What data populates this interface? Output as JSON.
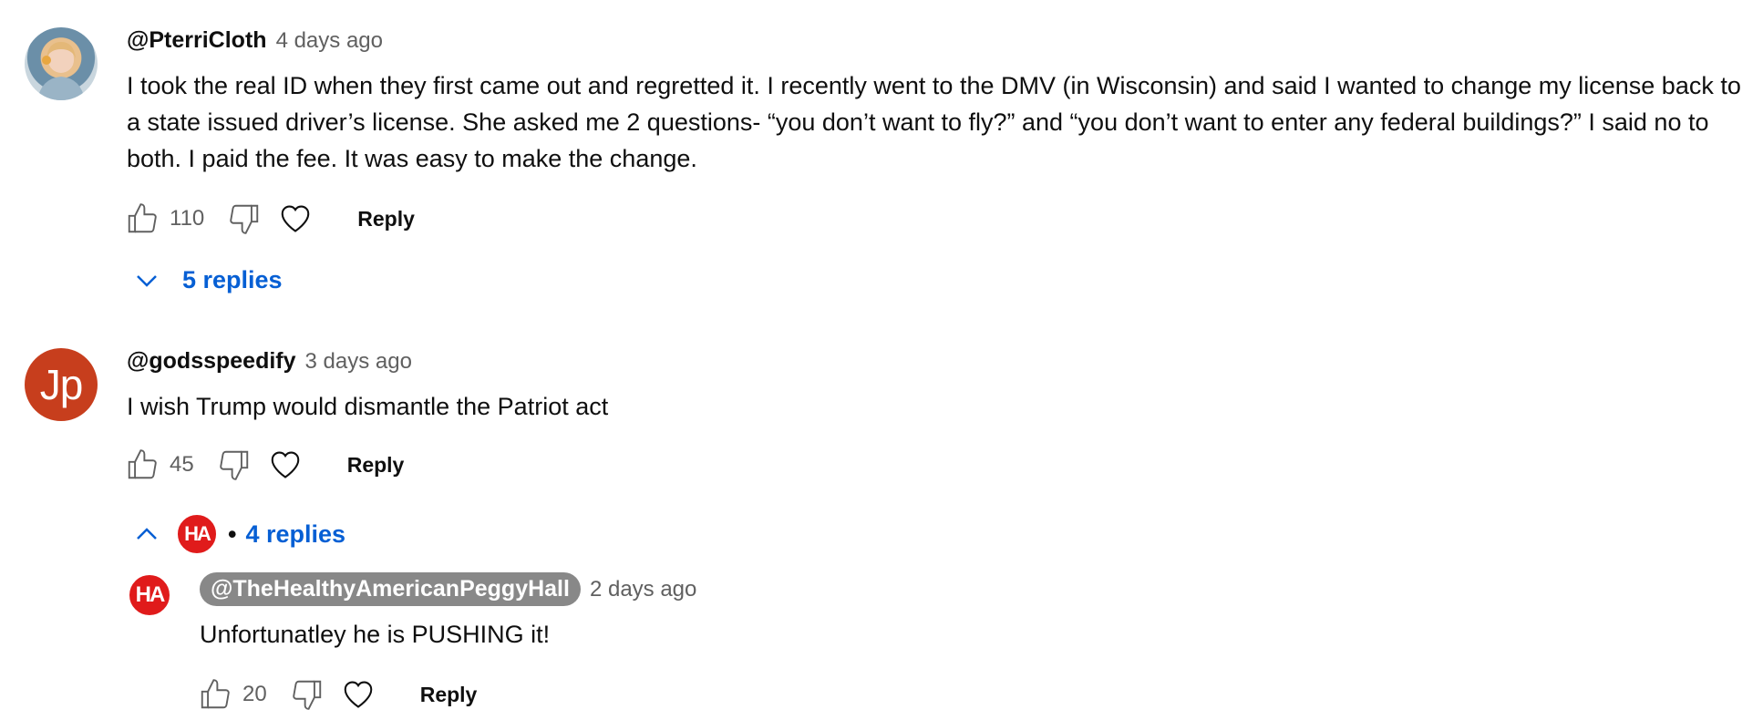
{
  "comments": [
    {
      "author": "@PterriCloth",
      "time": "4 days ago",
      "text": "I took the real ID when they first came out and regretted it. I recently went to the DMV (in Wisconsin) and said I wanted to change my license back to a state issued driver’s license. She asked me 2 questions- “you don’t want to fly?” and “you don’t want to enter any federal buildings?” I said no to both. I paid the fee. It was easy to make the change.",
      "likes": "110",
      "reply_label": "Reply",
      "replies_label": "5 replies"
    },
    {
      "author": "@godsspeedify",
      "avatar_letters": "Jp",
      "time": "3 days ago",
      "text": "I wish Trump would dismantle the Patriot act",
      "likes": "45",
      "reply_label": "Reply",
      "replies_label": "4 replies",
      "replies_separator": "•",
      "creator_avatar_letters": "HA"
    }
  ],
  "reply": {
    "avatar_letters": "HA",
    "author": "@TheHealthyAmericanPeggyHall",
    "time": "2 days ago",
    "text": "Unfortunatley he is PUSHING it!",
    "likes": "20",
    "reply_label": "Reply"
  },
  "colors": {
    "link_blue": "#065fd4",
    "creator_red": "#e01b1b",
    "avatar_jp": "#c73e1d",
    "creator_pill": "#888888"
  },
  "icons": {
    "like": "thumbs-up-icon",
    "dislike": "thumbs-down-icon",
    "heart": "heart-icon",
    "expand": "chevron-down-icon",
    "collapse": "chevron-up-icon"
  }
}
